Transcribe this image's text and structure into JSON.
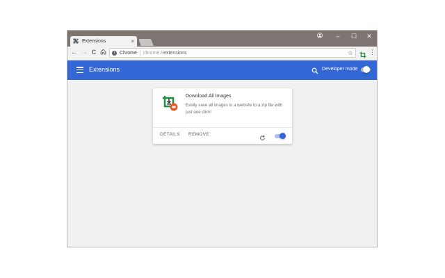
{
  "colors": {
    "titlebar": "#7d7572",
    "app_bar": "#3367d6",
    "content_bg": "#f1f1f1",
    "icon_green": "#1e8e3e",
    "icon_orange": "#e8572a"
  },
  "browser": {
    "tab": {
      "icon": "puzzle-icon",
      "title": "Extensions",
      "close": "×"
    },
    "window_controls": {
      "account": "account-icon",
      "minimize": "–",
      "maximize": "☐",
      "close": "✕"
    },
    "nav": {
      "back": "←",
      "forward": "→",
      "reload": "C",
      "home": "home-icon"
    },
    "omnibox": {
      "site_name": "Chrome",
      "url_scheme": "chrome://",
      "url_path": "extensions",
      "bookmark_icon": "star-icon"
    },
    "menu": "⋮"
  },
  "app_bar": {
    "menu_icon": "hamburger-icon",
    "title": "Extensions",
    "search_icon": "search-icon",
    "developer_mode_label": "Developer mode",
    "developer_mode_enabled": false
  },
  "extension": {
    "name": "Download All Images",
    "description": "Easily save all images in a website to a zip file with just one click!",
    "details_label": "DETAILS",
    "remove_label": "REMOVE",
    "reload_icon": "reload-icon",
    "enabled": true
  }
}
